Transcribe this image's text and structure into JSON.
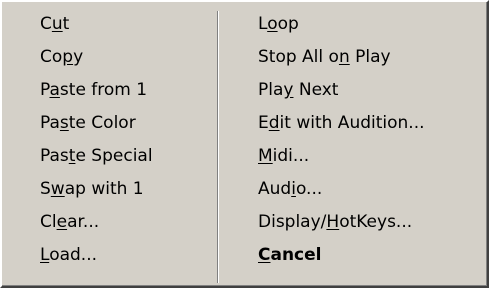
{
  "menu": {
    "left_column": [
      {
        "pre": "C",
        "key": "u",
        "post": "t"
      },
      {
        "pre": "Co",
        "key": "p",
        "post": "y"
      },
      {
        "pre": "P",
        "key": "a",
        "post": "ste from 1"
      },
      {
        "pre": "Pa",
        "key": "s",
        "post": "te Color"
      },
      {
        "pre": "Pas",
        "key": "t",
        "post": "e Special"
      },
      {
        "pre": "S",
        "key": "w",
        "post": "ap with 1"
      },
      {
        "pre": "Cl",
        "key": "e",
        "post": "ar..."
      },
      {
        "pre": "",
        "key": "L",
        "post": "oad..."
      }
    ],
    "right_column": [
      {
        "pre": "L",
        "key": "o",
        "post": "op"
      },
      {
        "pre": "Stop All o",
        "key": "n",
        "post": " Play"
      },
      {
        "pre": "Pla",
        "key": "y",
        "post": " Next"
      },
      {
        "pre": "E",
        "key": "d",
        "post": "it with Audition..."
      },
      {
        "pre": "",
        "key": "M",
        "post": "idi..."
      },
      {
        "pre": "Aud",
        "key": "i",
        "post": "o..."
      },
      {
        "pre": "Display/",
        "key": "H",
        "post": "otKeys..."
      },
      {
        "pre": "",
        "key": "C",
        "post": "ancel"
      }
    ]
  }
}
